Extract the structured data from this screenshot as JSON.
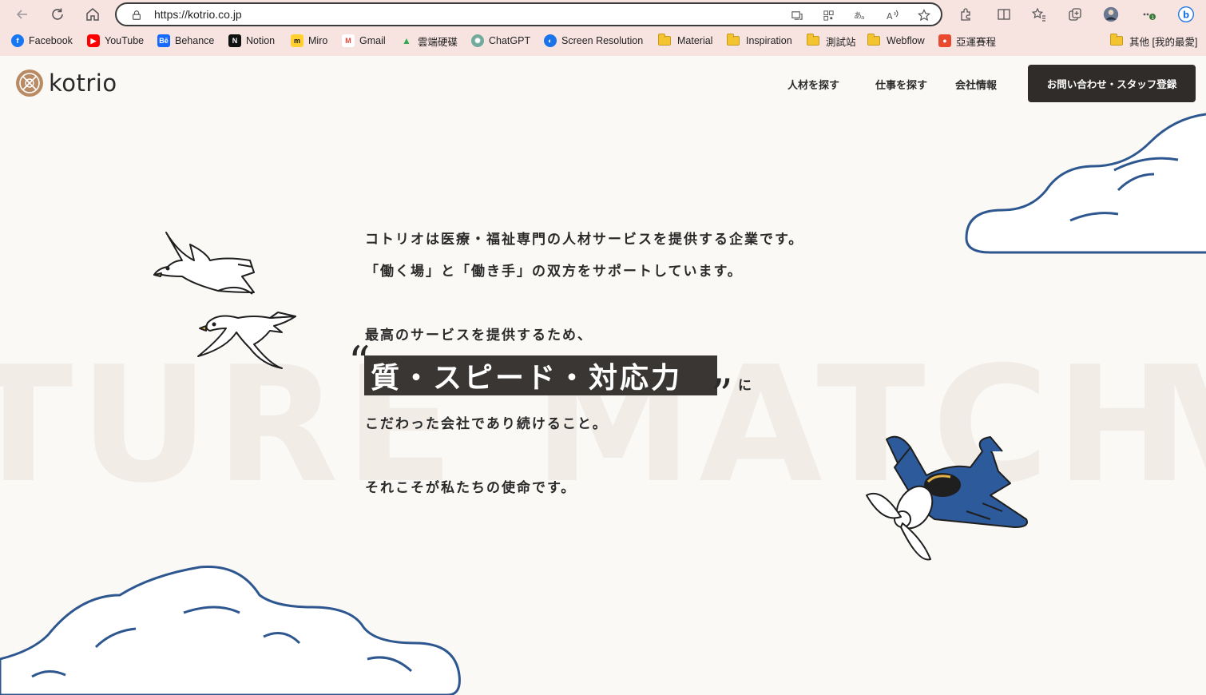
{
  "browser": {
    "url": "https://kotrio.co.jp",
    "bookmarks": [
      {
        "label": "Facebook",
        "icon": "facebook-icon",
        "color": "#1877f2"
      },
      {
        "label": "YouTube",
        "icon": "youtube-icon",
        "color": "#ff0000"
      },
      {
        "label": "Behance",
        "icon": "behance-icon",
        "color": "#1769ff"
      },
      {
        "label": "Notion",
        "icon": "notion-icon",
        "color": "#111111"
      },
      {
        "label": "Miro",
        "icon": "miro-icon",
        "color": "#ffd02f"
      },
      {
        "label": "Gmail",
        "icon": "gmail-icon",
        "color": "#ea4335"
      },
      {
        "label": "雲端硬碟",
        "icon": "google-drive-icon",
        "color": "#34a853"
      },
      {
        "label": "ChatGPT",
        "icon": "chatgpt-icon",
        "color": "#74aa9c"
      },
      {
        "label": "Screen Resolution",
        "icon": "screen-resolution-icon",
        "color": "#1a73e8"
      },
      {
        "label": "Material",
        "icon": "folder-icon"
      },
      {
        "label": "Inspiration",
        "icon": "folder-icon"
      },
      {
        "label": "測試站",
        "icon": "folder-icon"
      },
      {
        "label": "Webflow",
        "icon": "folder-icon"
      },
      {
        "label": "亞運賽程",
        "icon": "asian-games-icon",
        "color": "#e8492f"
      },
      {
        "label": "其他 [我的最愛]",
        "icon": "folder-icon"
      }
    ]
  },
  "site": {
    "logo_text": "kotrio",
    "nav": [
      "人材を探す",
      "仕事を探す",
      "会社情報"
    ],
    "cta": "お問い合わせ・スタッフ登録",
    "accent": "#2f2c29",
    "brand": "#b98b64"
  },
  "background_words": [
    "TURE",
    "MATCH",
    "V"
  ],
  "hero": {
    "line1": "コトリオは医療・福祉専門の人材サービスを提供する企業です。",
    "line2": "「働く場」と「働き手」の双方をサポートしています。",
    "line3": "最高のサービスを提供するため、",
    "open_quote": "“",
    "highlight": "質・スピード・対応力",
    "close_quote": "”",
    "suffix": "に",
    "line4": "こだわった会社であり続けること。",
    "line5": "それこそが私たちの使命です。"
  }
}
